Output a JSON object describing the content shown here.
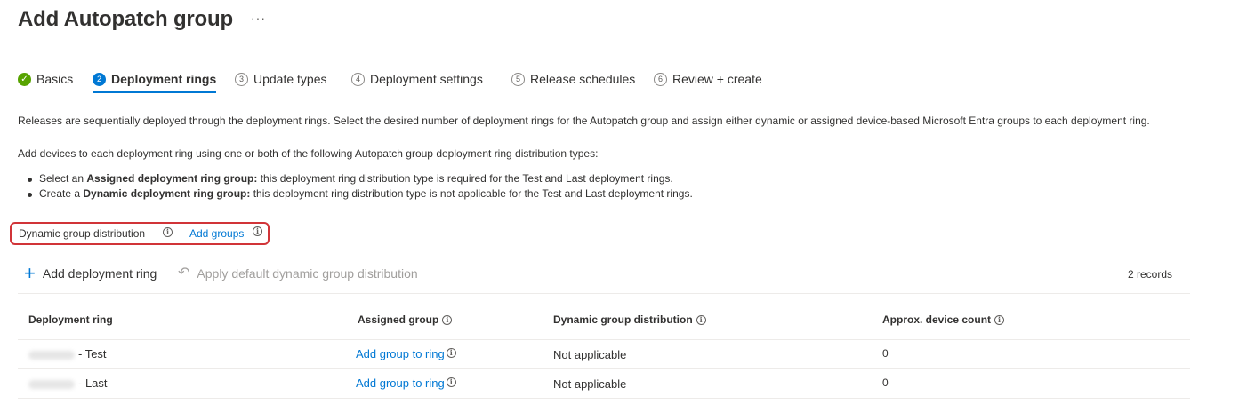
{
  "header": {
    "title": "Add Autopatch group",
    "more_label": "···"
  },
  "steps": [
    {
      "num": "✓",
      "label": "Basics"
    },
    {
      "num": "2",
      "label": "Deployment rings"
    },
    {
      "num": "3",
      "label": "Update types"
    },
    {
      "num": "4",
      "label": "Deployment settings"
    },
    {
      "num": "5",
      "label": "Release schedules"
    },
    {
      "num": "6",
      "label": "Review + create"
    }
  ],
  "content": {
    "intro": "Releases are sequentially deployed through the deployment rings. Select the desired number of deployment rings for the Autopatch group and assign either dynamic or assigned device-based Microsoft Entra groups to each deployment ring.",
    "add_devices": "Add devices to each deployment ring using one or both of the following Autopatch group deployment ring distribution types:",
    "bullets": [
      {
        "prefix": "Select an ",
        "bold": "Assigned deployment ring group:",
        "suffix": " this deployment ring distribution type is required for the Test and Last deployment rings."
      },
      {
        "prefix": "Create a ",
        "bold": "Dynamic deployment ring group:",
        "suffix": " this deployment ring distribution type is not applicable for the Test and Last deployment rings."
      }
    ]
  },
  "dynamic": {
    "label": "Dynamic group distribution",
    "link": "Add groups",
    "info": "i"
  },
  "toolbar": {
    "add_ring": "Add deployment ring",
    "apply_default": "Apply default dynamic group distribution",
    "records": "2 records"
  },
  "table": {
    "headers": [
      "Deployment ring",
      "Assigned group",
      "Dynamic group distribution",
      "Approx. device count"
    ],
    "rows": [
      {
        "ring": "- Test",
        "assigned": "Add group to ring",
        "dynamic": "Not applicable",
        "count": "0"
      },
      {
        "ring": "- Last",
        "assigned": "Add group to ring",
        "dynamic": "Not applicable",
        "count": "0"
      }
    ]
  },
  "colors": {
    "accent": "#0078d4",
    "success": "#57a300",
    "highlight": "#d13438"
  },
  "icons": {
    "basics_done": "checkmark-circle-icon",
    "add": "plus-icon",
    "apply": "undo-icon",
    "info": "info-icon",
    "more": "ellipsis-icon"
  }
}
